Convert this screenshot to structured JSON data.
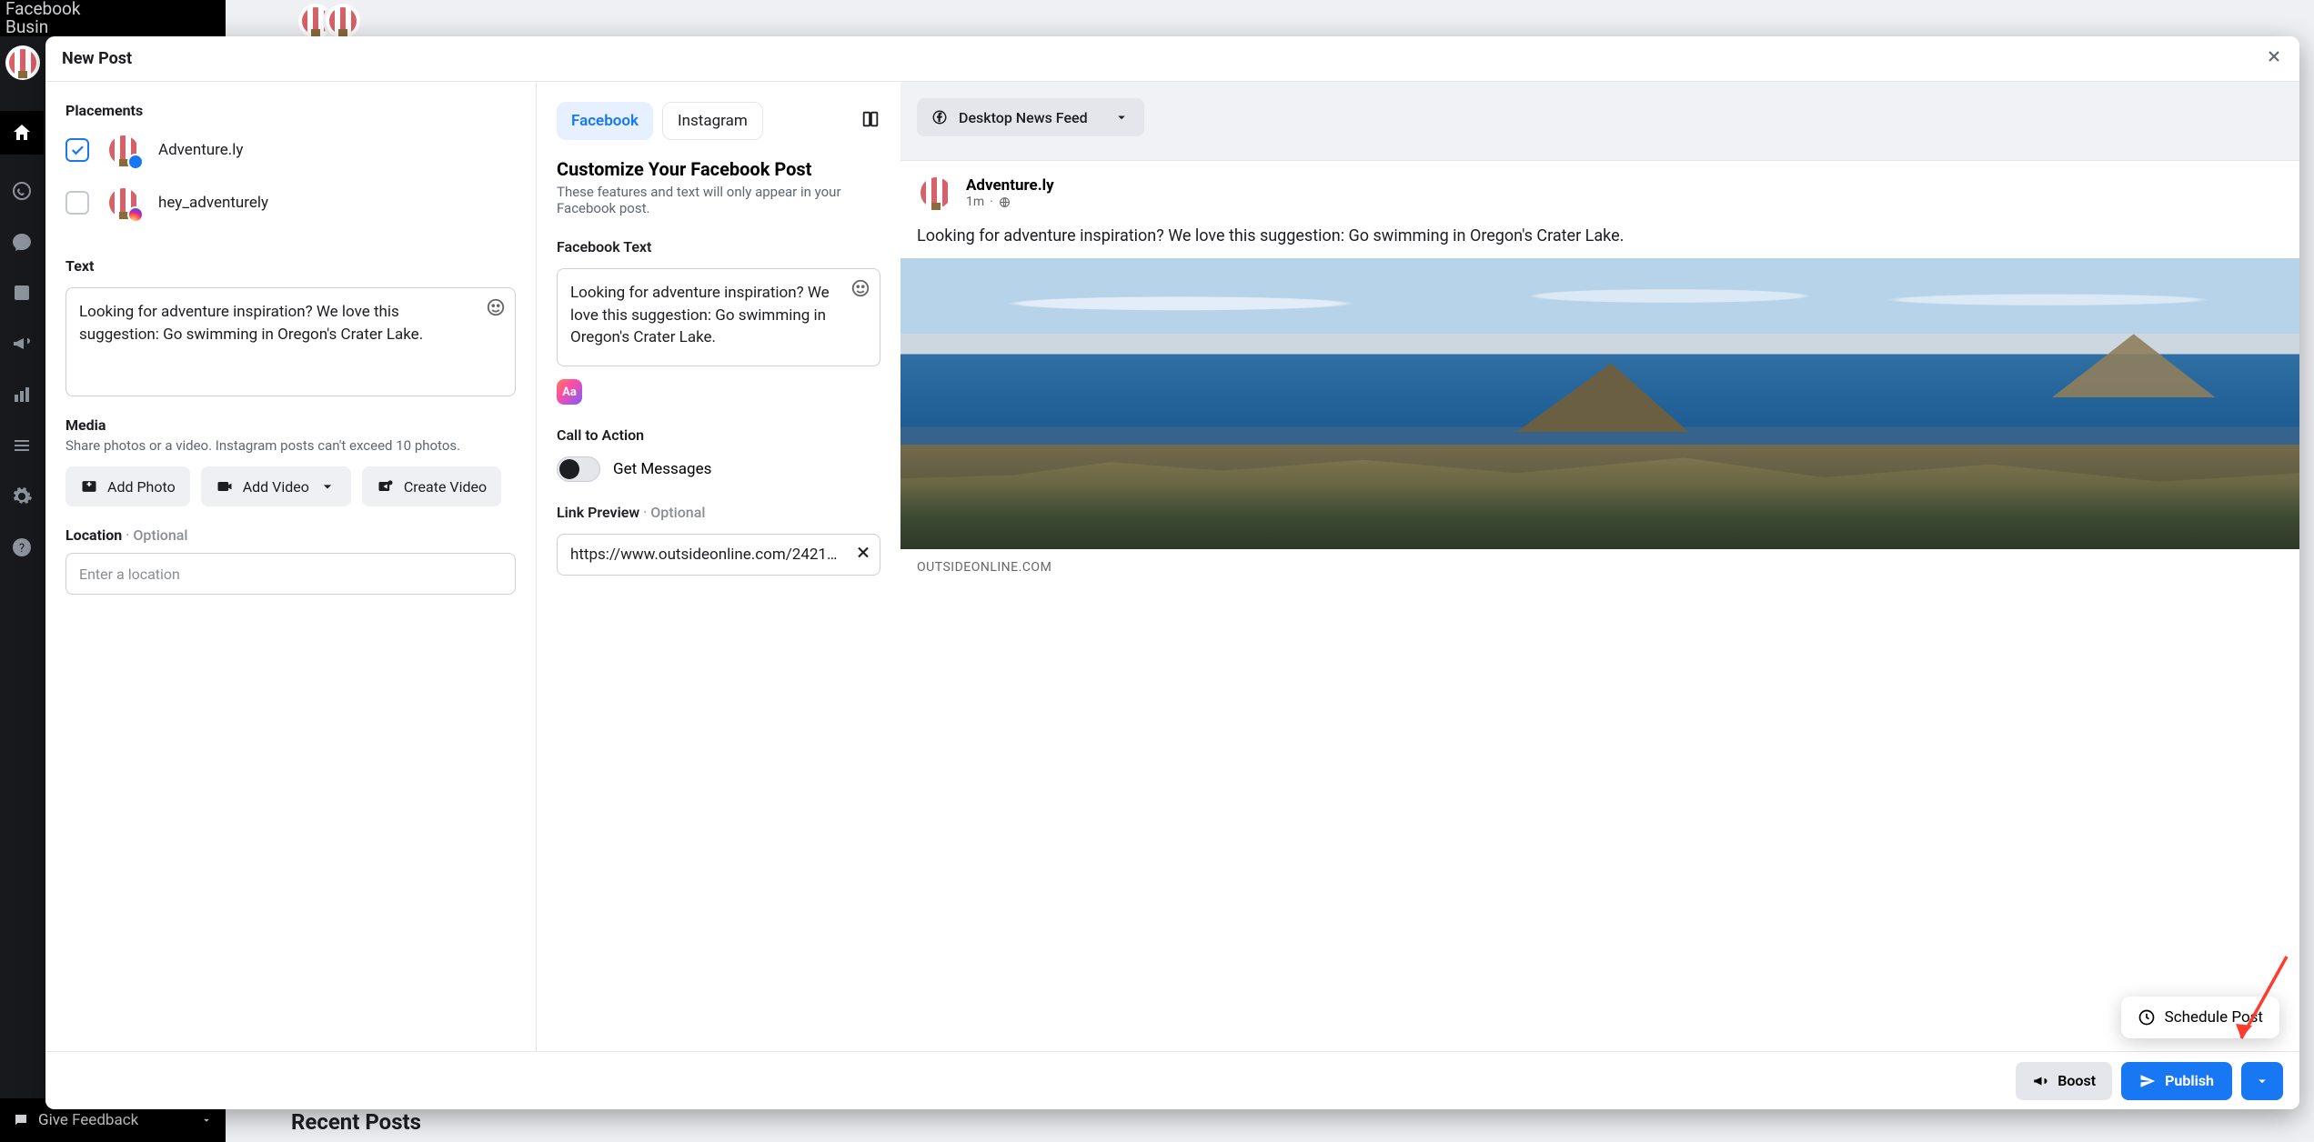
{
  "app": {
    "brand_line1": "Facebook",
    "brand_line2": "Busin",
    "feedback": "Give Feedback"
  },
  "background": {
    "recent_posts": "Recent Posts"
  },
  "modal": {
    "title": "New Post"
  },
  "left": {
    "placements_title": "Placements",
    "placements": [
      {
        "name": "Adventure.ly",
        "network": "facebook",
        "checked": true
      },
      {
        "name": "hey_adventurely",
        "network": "instagram",
        "checked": false
      }
    ],
    "text_title": "Text",
    "text_content": "Looking for adventure inspiration? We love this suggestion: Go swimming in Oregon's Crater Lake.",
    "media_title": "Media",
    "media_sub": "Share photos or a video. Instagram posts can't exceed 10 photos.",
    "add_photo": "Add Photo",
    "add_video": "Add Video",
    "create_video": "Create Video",
    "location_title": "Location",
    "optional": "Optional",
    "location_placeholder": "Enter a location"
  },
  "mid": {
    "tab_fb": "Facebook",
    "tab_ig": "Instagram",
    "customize_title": "Customize Your Facebook Post",
    "customize_sub": "These features and text will only appear in your Facebook post.",
    "fb_text_title": "Facebook Text",
    "fb_text_content": "Looking for adventure inspiration? We love this suggestion: Go swimming in Oregon's Crater Lake.",
    "cta_title": "Call to Action",
    "cta_option": "Get Messages",
    "link_title": "Link Preview",
    "optional": "Optional",
    "link_url": "https://www.outsideonline.com/2421…"
  },
  "right": {
    "feed_select": "Desktop News Feed",
    "page_name": "Adventure.ly",
    "post_time": "1m",
    "post_text": "Looking for adventure inspiration? We love this suggestion: Go swimming in Oregon's Crater Lake.",
    "link_domain": "OUTSIDEONLINE.COM",
    "schedule": "Schedule Post"
  },
  "footer": {
    "boost": "Boost",
    "publish": "Publish"
  }
}
